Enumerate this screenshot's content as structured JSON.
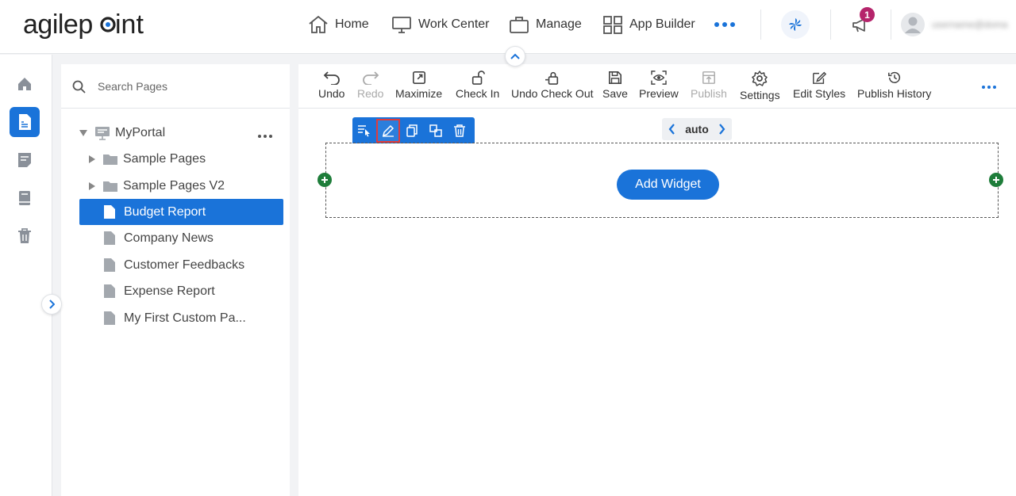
{
  "header": {
    "logo_text": "agilepoint",
    "nav": [
      {
        "label": "Home",
        "icon": "home-icon"
      },
      {
        "label": "Work Center",
        "icon": "monitor-icon"
      },
      {
        "label": "Manage",
        "icon": "briefcase-icon"
      },
      {
        "label": "App Builder",
        "icon": "grid-icon"
      }
    ],
    "notification_count": "1",
    "user_name": "username@domain"
  },
  "rail": {
    "items": [
      {
        "name": "home",
        "icon": "home-icon"
      },
      {
        "name": "pages",
        "icon": "page-icon",
        "active": true
      },
      {
        "name": "forms",
        "icon": "form-icon"
      },
      {
        "name": "book",
        "icon": "book-icon"
      },
      {
        "name": "trash",
        "icon": "trash-icon"
      }
    ]
  },
  "pages_panel": {
    "search_placeholder": "Search Pages",
    "root": "MyPortal",
    "folders": [
      "Sample Pages",
      "Sample Pages V2"
    ],
    "pages": [
      "Budget Report",
      "Company News",
      "Customer Feedbacks",
      "Expense Report",
      "My First Custom Pa..."
    ],
    "selected": "Budget Report"
  },
  "toolbar": {
    "undo": "Undo",
    "redo": "Redo",
    "maximize": "Maximize",
    "check_in": "Check In",
    "undo_check_out": "Undo Check Out",
    "save": "Save",
    "preview": "Preview",
    "publish": "Publish",
    "settings": "Settings",
    "edit_styles": "Edit Styles",
    "publish_history": "Publish History"
  },
  "canvas": {
    "width_mode": "auto",
    "add_widget_label": "Add Widget"
  },
  "colors": {
    "accent": "#1a73d9",
    "plus_green": "#1e7d3a",
    "badge": "#b5246b",
    "highlight": "#e13b3b"
  }
}
